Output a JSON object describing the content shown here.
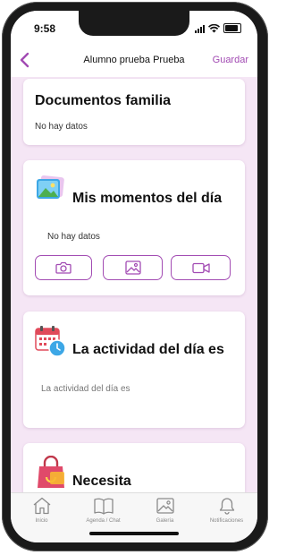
{
  "status": {
    "time": "9:58"
  },
  "nav": {
    "back_icon": "chevron-left-icon",
    "title": "Alumno prueba Prueba",
    "save_label": "Guardar"
  },
  "cards": {
    "documents": {
      "title": "Documentos familia",
      "empty": "No hay datos"
    },
    "moments": {
      "title": "Mis momentos del día",
      "empty": "No hay datos",
      "icon": "photos-icon",
      "buttons": [
        "camera-icon",
        "image-icon",
        "video-icon"
      ]
    },
    "activity": {
      "title": "La actividad del día es",
      "placeholder": "La actividad del día es",
      "icon": "calendar-clock-icon"
    },
    "needs": {
      "title": "Necesita",
      "icon": "bag-icon"
    }
  },
  "tabs": [
    {
      "label": "Inicio",
      "icon": "home-icon"
    },
    {
      "label": "Agenda / Chat",
      "icon": "book-icon"
    },
    {
      "label": "Galería",
      "icon": "gallery-icon"
    },
    {
      "label": "Notificaciones",
      "icon": "bell-icon"
    }
  ],
  "colors": {
    "accent": "#a24bb3",
    "background": "#f5e6f5"
  }
}
